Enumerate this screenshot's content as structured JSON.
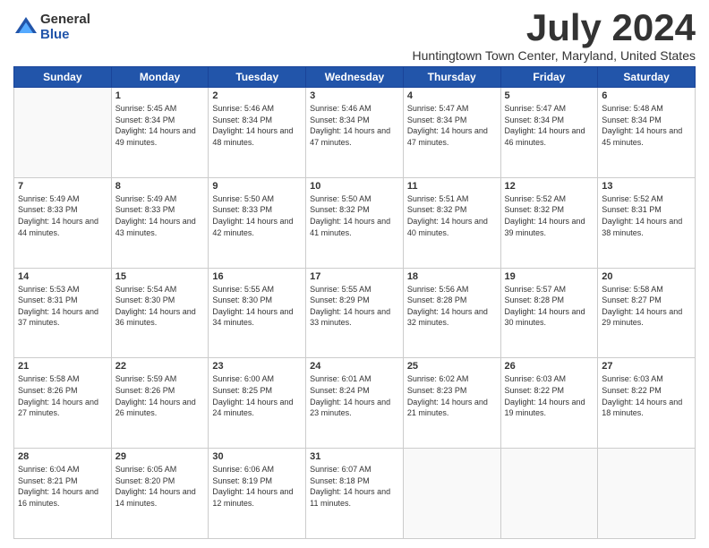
{
  "logo": {
    "general": "General",
    "blue": "Blue"
  },
  "title": "July 2024",
  "location": "Huntingtown Town Center, Maryland, United States",
  "headers": [
    "Sunday",
    "Monday",
    "Tuesday",
    "Wednesday",
    "Thursday",
    "Friday",
    "Saturday"
  ],
  "weeks": [
    [
      {
        "num": "",
        "sunrise": "",
        "sunset": "",
        "daylight": ""
      },
      {
        "num": "1",
        "sunrise": "Sunrise: 5:45 AM",
        "sunset": "Sunset: 8:34 PM",
        "daylight": "Daylight: 14 hours and 49 minutes."
      },
      {
        "num": "2",
        "sunrise": "Sunrise: 5:46 AM",
        "sunset": "Sunset: 8:34 PM",
        "daylight": "Daylight: 14 hours and 48 minutes."
      },
      {
        "num": "3",
        "sunrise": "Sunrise: 5:46 AM",
        "sunset": "Sunset: 8:34 PM",
        "daylight": "Daylight: 14 hours and 47 minutes."
      },
      {
        "num": "4",
        "sunrise": "Sunrise: 5:47 AM",
        "sunset": "Sunset: 8:34 PM",
        "daylight": "Daylight: 14 hours and 47 minutes."
      },
      {
        "num": "5",
        "sunrise": "Sunrise: 5:47 AM",
        "sunset": "Sunset: 8:34 PM",
        "daylight": "Daylight: 14 hours and 46 minutes."
      },
      {
        "num": "6",
        "sunrise": "Sunrise: 5:48 AM",
        "sunset": "Sunset: 8:34 PM",
        "daylight": "Daylight: 14 hours and 45 minutes."
      }
    ],
    [
      {
        "num": "7",
        "sunrise": "Sunrise: 5:49 AM",
        "sunset": "Sunset: 8:33 PM",
        "daylight": "Daylight: 14 hours and 44 minutes."
      },
      {
        "num": "8",
        "sunrise": "Sunrise: 5:49 AM",
        "sunset": "Sunset: 8:33 PM",
        "daylight": "Daylight: 14 hours and 43 minutes."
      },
      {
        "num": "9",
        "sunrise": "Sunrise: 5:50 AM",
        "sunset": "Sunset: 8:33 PM",
        "daylight": "Daylight: 14 hours and 42 minutes."
      },
      {
        "num": "10",
        "sunrise": "Sunrise: 5:50 AM",
        "sunset": "Sunset: 8:32 PM",
        "daylight": "Daylight: 14 hours and 41 minutes."
      },
      {
        "num": "11",
        "sunrise": "Sunrise: 5:51 AM",
        "sunset": "Sunset: 8:32 PM",
        "daylight": "Daylight: 14 hours and 40 minutes."
      },
      {
        "num": "12",
        "sunrise": "Sunrise: 5:52 AM",
        "sunset": "Sunset: 8:32 PM",
        "daylight": "Daylight: 14 hours and 39 minutes."
      },
      {
        "num": "13",
        "sunrise": "Sunrise: 5:52 AM",
        "sunset": "Sunset: 8:31 PM",
        "daylight": "Daylight: 14 hours and 38 minutes."
      }
    ],
    [
      {
        "num": "14",
        "sunrise": "Sunrise: 5:53 AM",
        "sunset": "Sunset: 8:31 PM",
        "daylight": "Daylight: 14 hours and 37 minutes."
      },
      {
        "num": "15",
        "sunrise": "Sunrise: 5:54 AM",
        "sunset": "Sunset: 8:30 PM",
        "daylight": "Daylight: 14 hours and 36 minutes."
      },
      {
        "num": "16",
        "sunrise": "Sunrise: 5:55 AM",
        "sunset": "Sunset: 8:30 PM",
        "daylight": "Daylight: 14 hours and 34 minutes."
      },
      {
        "num": "17",
        "sunrise": "Sunrise: 5:55 AM",
        "sunset": "Sunset: 8:29 PM",
        "daylight": "Daylight: 14 hours and 33 minutes."
      },
      {
        "num": "18",
        "sunrise": "Sunrise: 5:56 AM",
        "sunset": "Sunset: 8:28 PM",
        "daylight": "Daylight: 14 hours and 32 minutes."
      },
      {
        "num": "19",
        "sunrise": "Sunrise: 5:57 AM",
        "sunset": "Sunset: 8:28 PM",
        "daylight": "Daylight: 14 hours and 30 minutes."
      },
      {
        "num": "20",
        "sunrise": "Sunrise: 5:58 AM",
        "sunset": "Sunset: 8:27 PM",
        "daylight": "Daylight: 14 hours and 29 minutes."
      }
    ],
    [
      {
        "num": "21",
        "sunrise": "Sunrise: 5:58 AM",
        "sunset": "Sunset: 8:26 PM",
        "daylight": "Daylight: 14 hours and 27 minutes."
      },
      {
        "num": "22",
        "sunrise": "Sunrise: 5:59 AM",
        "sunset": "Sunset: 8:26 PM",
        "daylight": "Daylight: 14 hours and 26 minutes."
      },
      {
        "num": "23",
        "sunrise": "Sunrise: 6:00 AM",
        "sunset": "Sunset: 8:25 PM",
        "daylight": "Daylight: 14 hours and 24 minutes."
      },
      {
        "num": "24",
        "sunrise": "Sunrise: 6:01 AM",
        "sunset": "Sunset: 8:24 PM",
        "daylight": "Daylight: 14 hours and 23 minutes."
      },
      {
        "num": "25",
        "sunrise": "Sunrise: 6:02 AM",
        "sunset": "Sunset: 8:23 PM",
        "daylight": "Daylight: 14 hours and 21 minutes."
      },
      {
        "num": "26",
        "sunrise": "Sunrise: 6:03 AM",
        "sunset": "Sunset: 8:22 PM",
        "daylight": "Daylight: 14 hours and 19 minutes."
      },
      {
        "num": "27",
        "sunrise": "Sunrise: 6:03 AM",
        "sunset": "Sunset: 8:22 PM",
        "daylight": "Daylight: 14 hours and 18 minutes."
      }
    ],
    [
      {
        "num": "28",
        "sunrise": "Sunrise: 6:04 AM",
        "sunset": "Sunset: 8:21 PM",
        "daylight": "Daylight: 14 hours and 16 minutes."
      },
      {
        "num": "29",
        "sunrise": "Sunrise: 6:05 AM",
        "sunset": "Sunset: 8:20 PM",
        "daylight": "Daylight: 14 hours and 14 minutes."
      },
      {
        "num": "30",
        "sunrise": "Sunrise: 6:06 AM",
        "sunset": "Sunset: 8:19 PM",
        "daylight": "Daylight: 14 hours and 12 minutes."
      },
      {
        "num": "31",
        "sunrise": "Sunrise: 6:07 AM",
        "sunset": "Sunset: 8:18 PM",
        "daylight": "Daylight: 14 hours and 11 minutes."
      },
      {
        "num": "",
        "sunrise": "",
        "sunset": "",
        "daylight": ""
      },
      {
        "num": "",
        "sunrise": "",
        "sunset": "",
        "daylight": ""
      },
      {
        "num": "",
        "sunrise": "",
        "sunset": "",
        "daylight": ""
      }
    ]
  ]
}
